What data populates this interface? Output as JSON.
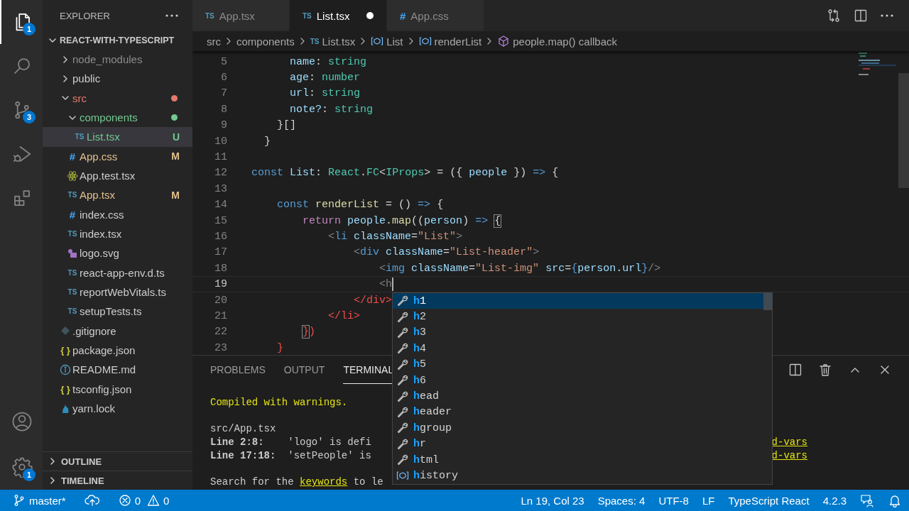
{
  "activity_bar": {
    "items": [
      {
        "kind": "explorer",
        "selected": true,
        "badge": "1"
      },
      {
        "kind": "search",
        "selected": false
      },
      {
        "kind": "source-control",
        "selected": false,
        "badge": "3"
      },
      {
        "kind": "run-debug",
        "selected": false
      },
      {
        "kind": "extensions",
        "selected": false
      }
    ],
    "bottom": [
      {
        "kind": "account"
      },
      {
        "kind": "settings",
        "badge": "1"
      }
    ]
  },
  "sidebar": {
    "title": "EXPLORER",
    "folder": {
      "name": "REACT-WITH-TYPESCRIPT",
      "expanded": true
    },
    "tree": [
      {
        "name": "node_modules",
        "kind": "folder",
        "expanded": false,
        "color": "#8c8c8c",
        "dot": false,
        "selected": false
      },
      {
        "name": "public",
        "kind": "folder",
        "expanded": false,
        "color": "#cccccc",
        "dot": false,
        "selected": false
      },
      {
        "name": "src",
        "kind": "folder",
        "expanded": true,
        "color": "#e37a6c",
        "dot": true,
        "selected": false,
        "children": [
          {
            "name": "components",
            "kind": "folder",
            "expanded": true,
            "color": "#73c991",
            "dot": true,
            "selected": false,
            "children": [
              {
                "name": "List.tsx",
                "kind": "ts",
                "icon_text": "TS",
                "color": "#73c991",
                "badge": "U",
                "selected": true
              }
            ]
          },
          {
            "name": "App.css",
            "kind": "css",
            "icon_text": "#",
            "color": "#e2c08d",
            "badge": "M",
            "selected": false
          },
          {
            "name": "App.test.tsx",
            "kind": "react",
            "color": "#cccccc",
            "selected": false
          },
          {
            "name": "App.tsx",
            "kind": "ts",
            "icon_text": "TS",
            "color": "#e2c08d",
            "badge": "M",
            "selected": false
          },
          {
            "name": "index.css",
            "kind": "css",
            "icon_text": "#",
            "color": "#cccccc",
            "selected": false
          },
          {
            "name": "index.tsx",
            "kind": "ts",
            "icon_text": "TS",
            "color": "#cccccc",
            "selected": false
          },
          {
            "name": "logo.svg",
            "kind": "svg",
            "color": "#cccccc",
            "selected": false
          },
          {
            "name": "react-app-env.d.ts",
            "kind": "ts",
            "icon_text": "TS",
            "color": "#cccccc",
            "selected": false
          },
          {
            "name": "reportWebVitals.ts",
            "kind": "ts",
            "icon_text": "TS",
            "color": "#cccccc",
            "selected": false
          },
          {
            "name": "setupTests.ts",
            "kind": "ts",
            "icon_text": "TS",
            "color": "#cccccc",
            "selected": false
          }
        ]
      },
      {
        "name": ".gitignore",
        "kind": "git",
        "color": "#cccccc",
        "selected": false
      },
      {
        "name": "package.json",
        "kind": "json",
        "icon_text": "{ }",
        "color": "#cccccc",
        "selected": false
      },
      {
        "name": "README.md",
        "kind": "info",
        "color": "#cccccc",
        "selected": false
      },
      {
        "name": "tsconfig.json",
        "kind": "json",
        "icon_text": "{ }",
        "color": "#cccccc",
        "selected": false
      },
      {
        "name": "yarn.lock",
        "kind": "yarn",
        "color": "#cccccc",
        "selected": false
      }
    ],
    "sections": [
      {
        "title": "OUTLINE",
        "expanded": false
      },
      {
        "title": "TIMELINE",
        "expanded": false
      }
    ]
  },
  "editor_tabs": [
    {
      "label": "App.tsx",
      "kind": "ts",
      "icon_text": "TS",
      "selected": false,
      "modified": false
    },
    {
      "label": "List.tsx",
      "kind": "ts",
      "icon_text": "TS",
      "selected": true,
      "modified": true
    },
    {
      "label": "App.css",
      "kind": "css",
      "icon_text": "#",
      "selected": false,
      "modified": false
    }
  ],
  "breadcrumbs": [
    {
      "label": "src",
      "kind": "folder"
    },
    {
      "label": "components",
      "kind": "folder"
    },
    {
      "label": "List.tsx",
      "kind": "ts",
      "icon_text": "TS"
    },
    {
      "label": "List",
      "kind": "variable"
    },
    {
      "label": "renderList",
      "kind": "variable"
    },
    {
      "label": "people.map() callback",
      "kind": "method"
    }
  ],
  "code": {
    "lines": [
      {
        "number": "5",
        "cursor": false,
        "tokens": [
          {
            "kind": "variable",
            "text": "      name"
          },
          {
            "kind": "plain",
            "text": ": "
          },
          {
            "kind": "type",
            "text": "string"
          }
        ]
      },
      {
        "number": "6",
        "cursor": false,
        "tokens": [
          {
            "kind": "variable",
            "text": "      age"
          },
          {
            "kind": "plain",
            "text": ": "
          },
          {
            "kind": "type",
            "text": "number"
          }
        ]
      },
      {
        "number": "7",
        "cursor": false,
        "tokens": [
          {
            "kind": "variable",
            "text": "      url"
          },
          {
            "kind": "plain",
            "text": ": "
          },
          {
            "kind": "type",
            "text": "string"
          }
        ]
      },
      {
        "number": "8",
        "cursor": false,
        "tokens": [
          {
            "kind": "variable",
            "text": "      note?"
          },
          {
            "kind": "plain",
            "text": ": "
          },
          {
            "kind": "type",
            "text": "string"
          }
        ]
      },
      {
        "number": "9",
        "cursor": false,
        "tokens": [
          {
            "kind": "plain",
            "text": "    }[]"
          }
        ]
      },
      {
        "number": "10",
        "cursor": false,
        "tokens": [
          {
            "kind": "plain",
            "text": "  }"
          }
        ]
      },
      {
        "number": "11",
        "cursor": false
      },
      {
        "number": "12",
        "cursor": false,
        "tokens": [
          {
            "kind": "keyword",
            "text": "const"
          },
          {
            "kind": "variable",
            "text": " List"
          },
          {
            "kind": "plain",
            "text": ": "
          },
          {
            "kind": "type",
            "text": "React"
          },
          {
            "kind": "plain",
            "text": "."
          },
          {
            "kind": "type",
            "text": "FC"
          },
          {
            "kind": "plain",
            "text": "<"
          },
          {
            "kind": "type",
            "text": "IProps"
          },
          {
            "kind": "plain",
            "text": "> = ({ "
          },
          {
            "kind": "variable",
            "text": "people"
          },
          {
            "kind": "plain",
            "text": " }) "
          },
          {
            "kind": "keyword",
            "text": "=>"
          },
          {
            "kind": "plain",
            "text": " {"
          }
        ]
      },
      {
        "number": "13",
        "cursor": false
      },
      {
        "number": "14",
        "cursor": false,
        "tokens": [
          {
            "kind": "keyword",
            "text": "    const"
          },
          {
            "kind": "function",
            "text": " renderList"
          },
          {
            "kind": "plain",
            "text": " = () "
          },
          {
            "kind": "keyword",
            "text": "=>"
          },
          {
            "kind": "plain",
            "text": " {"
          }
        ]
      },
      {
        "number": "15",
        "cursor": false,
        "tokens": [
          {
            "kind": "control",
            "text": "        return"
          },
          {
            "kind": "variable",
            "text": " people"
          },
          {
            "kind": "plain",
            "text": "."
          },
          {
            "kind": "function",
            "text": "map"
          },
          {
            "kind": "plain",
            "text": "(("
          },
          {
            "kind": "variable",
            "text": "person"
          },
          {
            "kind": "plain",
            "text": ") "
          },
          {
            "kind": "keyword",
            "text": "=> "
          },
          {
            "kind": "bracket-match",
            "text": "{"
          }
        ]
      },
      {
        "number": "16",
        "cursor": false,
        "tokens": [
          {
            "kind": "tag-bracket",
            "text": "            <"
          },
          {
            "kind": "tag",
            "text": "li"
          },
          {
            "kind": "variable",
            "text": " className"
          },
          {
            "kind": "plain",
            "text": "="
          },
          {
            "kind": "string",
            "text": "\"List\""
          },
          {
            "kind": "tag-bracket",
            "text": ">"
          }
        ]
      },
      {
        "number": "17",
        "cursor": false,
        "tokens": [
          {
            "kind": "tag-bracket",
            "text": "                <"
          },
          {
            "kind": "tag",
            "text": "div"
          },
          {
            "kind": "variable",
            "text": " className"
          },
          {
            "kind": "plain",
            "text": "="
          },
          {
            "kind": "string",
            "text": "\"List-header\""
          },
          {
            "kind": "tag-bracket",
            "text": ">"
          }
        ]
      },
      {
        "number": "18",
        "cursor": false,
        "tokens": [
          {
            "kind": "tag-bracket",
            "text": "                    <"
          },
          {
            "kind": "tag",
            "text": "img"
          },
          {
            "kind": "variable",
            "text": " className"
          },
          {
            "kind": "plain",
            "text": "="
          },
          {
            "kind": "string",
            "text": "\"List-img\""
          },
          {
            "kind": "variable",
            "text": " src"
          },
          {
            "kind": "plain",
            "text": "="
          },
          {
            "kind": "keyword",
            "text": "{"
          },
          {
            "kind": "variable",
            "text": "person"
          },
          {
            "kind": "plain",
            "text": "."
          },
          {
            "kind": "variable",
            "text": "url"
          },
          {
            "kind": "keyword",
            "text": "}"
          },
          {
            "kind": "tag-bracket",
            "text": "/>"
          }
        ]
      },
      {
        "number": "19",
        "cursor": true,
        "tokens": [
          {
            "kind": "tag-bracket",
            "text": "                    <h"
          }
        ]
      },
      {
        "number": "20",
        "cursor": false,
        "tokens": [
          {
            "kind": "error",
            "text": "                </div>"
          }
        ]
      },
      {
        "number": "21",
        "cursor": false,
        "tokens": [
          {
            "kind": "error",
            "text": "            </li>"
          }
        ]
      },
      {
        "number": "22",
        "cursor": false,
        "tokens": [
          {
            "kind": "bracket-match-error",
            "text": "        }"
          },
          {
            "kind": "error",
            "text": ")"
          }
        ]
      },
      {
        "number": "23",
        "cursor": false,
        "tokens": [
          {
            "kind": "error",
            "text": "    }"
          }
        ]
      }
    ]
  },
  "suggestions": [
    {
      "kind": "property",
      "label": "**h**1",
      "selected": true
    },
    {
      "kind": "property",
      "label": "**h**2",
      "selected": false
    },
    {
      "kind": "property",
      "label": "**h**3",
      "selected": false
    },
    {
      "kind": "property",
      "label": "**h**4",
      "selected": false
    },
    {
      "kind": "property",
      "label": "**h**5",
      "selected": false
    },
    {
      "kind": "property",
      "label": "**h**6",
      "selected": false
    },
    {
      "kind": "property",
      "label": "**h**ead",
      "selected": false
    },
    {
      "kind": "property",
      "label": "**h**eader",
      "selected": false
    },
    {
      "kind": "property",
      "label": "**h**group",
      "selected": false
    },
    {
      "kind": "property",
      "label": "**h**r",
      "selected": false
    },
    {
      "kind": "property",
      "label": "**h**tml",
      "selected": false
    },
    {
      "kind": "variable",
      "label": "**h**istory",
      "selected": false
    }
  ],
  "panel": {
    "tabs": [
      {
        "label": "PROBLEMS",
        "selected": false
      },
      {
        "label": "OUTPUT",
        "selected": false
      },
      {
        "label": "TERMINAL",
        "selected": true
      }
    ],
    "terminal": [
      {
        "kind": "title",
        "text": "Compiled with warnings."
      },
      {
        "kind": "path",
        "text": "src/App.tsx"
      },
      {
        "kind": "warning",
        "text": "**Line 2:8:**    'logo' is defi",
        "rule": "d-vars"
      },
      {
        "kind": "warning",
        "text": "**Line 17:18:**  'setPeople' is",
        "rule": "d-vars"
      },
      {
        "kind": "hint",
        "before": "Search for the",
        "link": "keywords",
        "after": "to le"
      }
    ]
  },
  "status_bar": {
    "left": [
      {
        "kind": "branch",
        "label": "master*"
      },
      {
        "kind": "sync"
      },
      {
        "kind": "problems",
        "errors": "0",
        "warnings": "0"
      }
    ],
    "right": [
      {
        "kind": "text",
        "label": "Ln 19, Col 23"
      },
      {
        "kind": "text",
        "label": "Spaces: 4"
      },
      {
        "kind": "text",
        "label": "UTF-8"
      },
      {
        "kind": "text",
        "label": "LF"
      },
      {
        "kind": "text",
        "label": "TypeScript React"
      },
      {
        "kind": "text",
        "label": "4.2.3"
      },
      {
        "kind": "feedback"
      },
      {
        "kind": "bell"
      }
    ]
  }
}
